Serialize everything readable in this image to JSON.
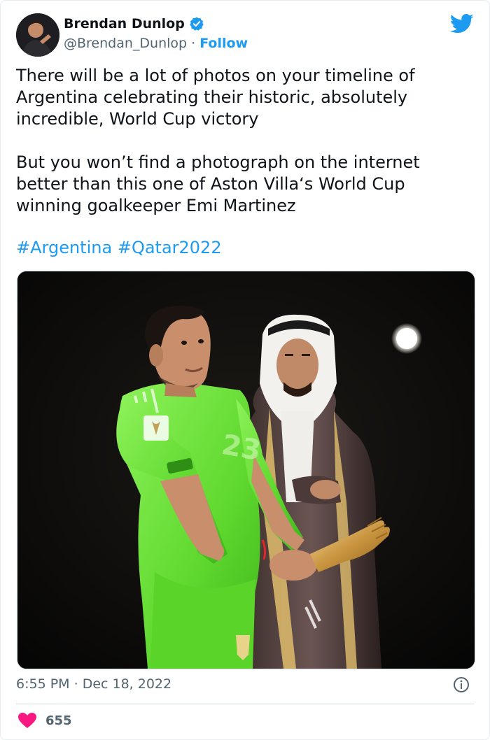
{
  "author": {
    "display_name": "Brendan Dunlop",
    "handle": "@Brendan_Dunlop",
    "separator": " · ",
    "follow_label": "Follow",
    "verified": true
  },
  "tweet": {
    "paragraph1": "There will be a lot of photos on your timeline of Argentina celebrating their historic, absolutely incredible, World Cup victory",
    "paragraph2": "But you won’t find a photograph on the internet better than this one of Aston Villa‘s World Cup winning goalkeeper Emi Martinez",
    "hashtags": [
      "#Argentina",
      "#Qatar2022"
    ]
  },
  "photo": {
    "jersey_number": "23"
  },
  "footer": {
    "time": "6:55 PM",
    "separator": " · ",
    "date": "Dec 18, 2022",
    "likes": "655"
  },
  "colors": {
    "accent": "#1d9bf0",
    "heart": "#f91880",
    "jersey": "#6ee83a"
  },
  "icons": [
    "verified-badge-icon",
    "twitter-bird-icon",
    "info-icon",
    "heart-icon"
  ]
}
